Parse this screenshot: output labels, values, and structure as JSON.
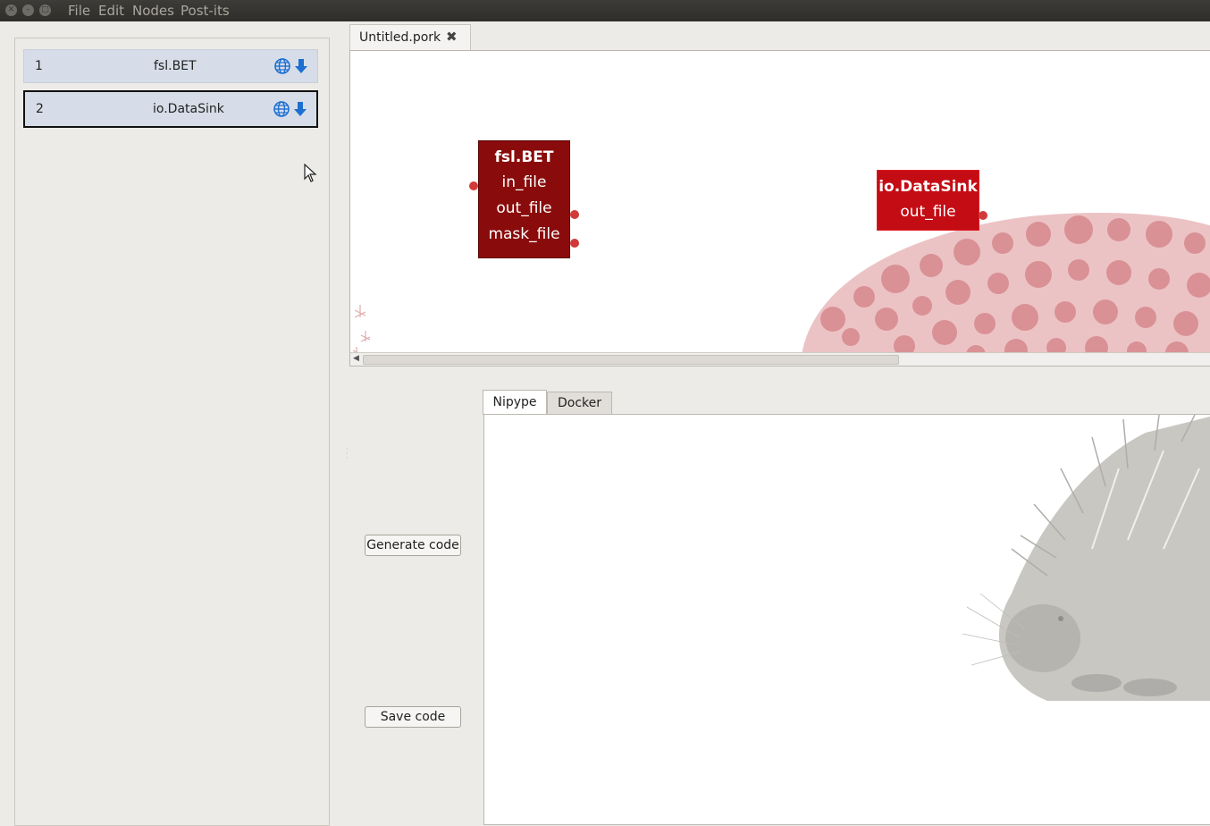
{
  "menu": [
    "File",
    "Edit",
    "Nodes",
    "Post-its"
  ],
  "node_list": [
    {
      "index": "1",
      "name": "fsl.BET"
    },
    {
      "index": "2",
      "name": "io.DataSink"
    }
  ],
  "document_tab": {
    "title": "Untitled.pork",
    "close_glyph": "✖"
  },
  "graph_nodes": [
    {
      "title": "fsl.BET",
      "ports": [
        "in_file",
        "out_file",
        "mask_file"
      ]
    },
    {
      "title": "io.DataSink",
      "ports": [
        "out_file"
      ]
    }
  ],
  "buttons": {
    "generate": "Generate code",
    "save": "Save code"
  },
  "code_tabs": [
    "Nipype",
    "Docker"
  ],
  "colors": {
    "node_dark": "#8a0b0b",
    "node_bright": "#c40c14",
    "port": "#d23a3a",
    "selected_row": "#d6dde8"
  }
}
